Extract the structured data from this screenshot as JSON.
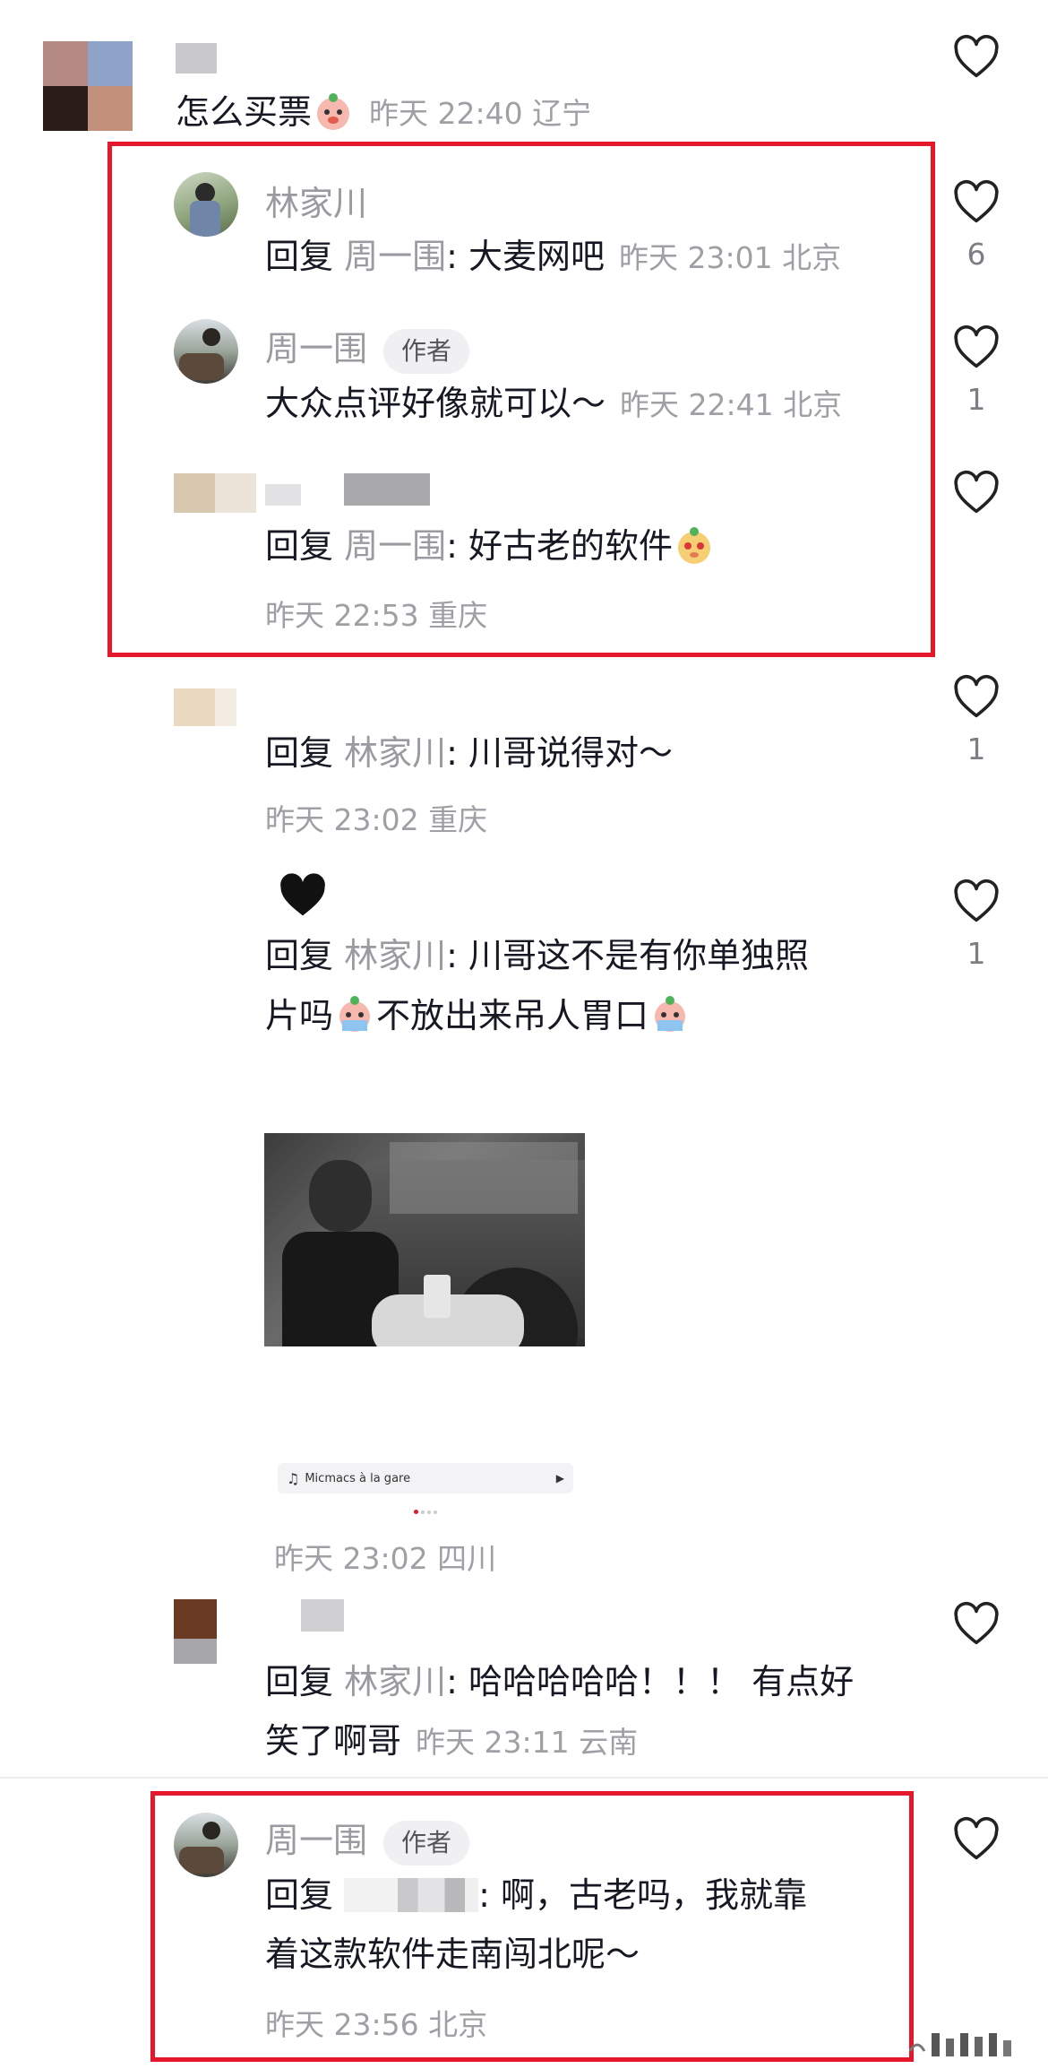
{
  "comments": {
    "top": {
      "text": "怎么买票",
      "time": "昨天 22:40 辽宁"
    },
    "r1": {
      "name": "林家川",
      "reply_label": "回复",
      "reply_to": "周一围",
      "text": ": 大麦网吧",
      "time": "昨天 23:01 北京",
      "likes": "6"
    },
    "r2": {
      "name": "周一围",
      "badge": "作者",
      "text": "大众点评好像就可以～",
      "time": "昨天 22:41 北京",
      "likes": "1"
    },
    "r3": {
      "reply_label": "回复",
      "reply_to": "周一围",
      "text": ": 好古老的软件",
      "time": "昨天 22:53 重庆"
    },
    "r4": {
      "reply_label": "回复",
      "reply_to": "林家川",
      "text": ": 川哥说得对～",
      "time": "昨天 23:02 重庆",
      "likes": "1"
    },
    "r5": {
      "reply_label": "回复",
      "reply_to": "林家川",
      "line1": ": 川哥这不是有你单独照",
      "line2a": "片吗",
      "line2b": "不放出来吊人胃口",
      "music": "Micmacs à la gare",
      "time": "昨天 23:02 四川",
      "likes": "1"
    },
    "r6": {
      "reply_label": "回复",
      "reply_to": "林家川",
      "line1": ": 哈哈哈哈哈！！！ 有点好",
      "line2": "笑了啊哥",
      "time": "昨天 23:11 云南"
    },
    "r7": {
      "name": "周一围",
      "badge": "作者",
      "reply_label": "回复",
      "line1": ": 啊，古老吗，我就靠",
      "line2": "着这款软件走南闯北呢～",
      "time": "昨天 23:56 北京"
    }
  },
  "colors": {
    "highlight": "#e4172b",
    "meta": "#9fa0a5"
  },
  "icons": [
    "heart-outline-icon",
    "black-heart-emoji",
    "music-note-icon",
    "play-icon"
  ]
}
